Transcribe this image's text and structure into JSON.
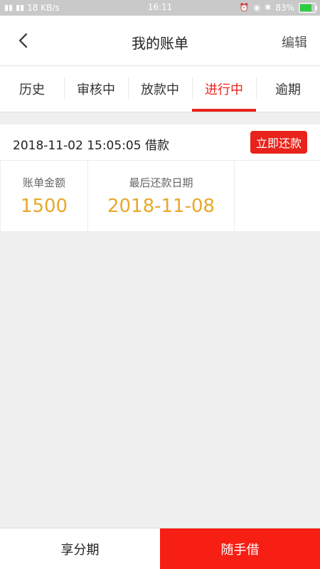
{
  "status_bar": {
    "network": "18 KB/s",
    "time": "16:11",
    "battery": "83%"
  },
  "header": {
    "title": "我的账单",
    "edit_label": "编辑",
    "back_icon": "chevron-left-icon"
  },
  "tabs": [
    {
      "label": "历史",
      "active": false
    },
    {
      "label": "审核中",
      "active": false
    },
    {
      "label": "放款中",
      "active": false
    },
    {
      "label": "进行中",
      "active": true
    },
    {
      "label": "逾期",
      "active": false
    }
  ],
  "bill": {
    "date_text": "2018-11-02 15:05:05 借款",
    "repay_label": "立即还款",
    "amount_label": "账单金额",
    "amount_value": "1500",
    "due_label": "最后还款日期",
    "due_value": "2018-11-08"
  },
  "bottom": {
    "left_label": "享分期",
    "right_label": "随手借"
  },
  "colors": {
    "accent": "#e8231b",
    "value": "#e8a82a",
    "bottom_right": "#f71e13"
  }
}
